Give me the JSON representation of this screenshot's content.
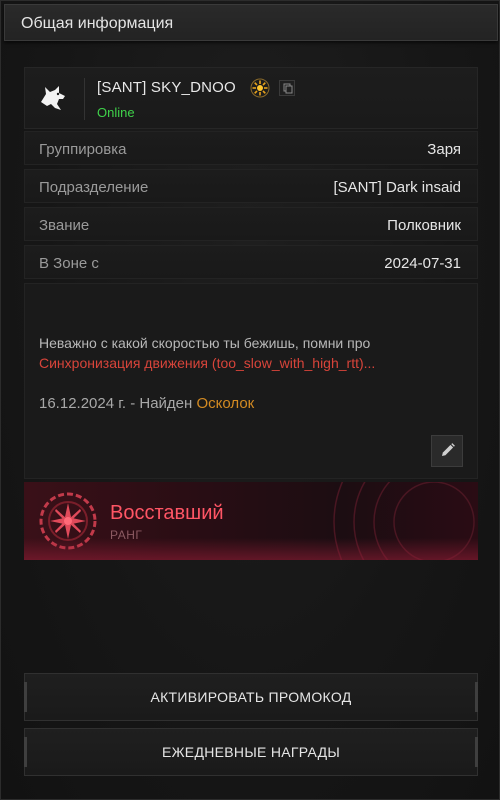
{
  "header": {
    "title": "Общая информация"
  },
  "profile": {
    "name": "[SANT] SKY_DNOO",
    "status": "Online",
    "colors": {
      "status": "#3fd14a",
      "badge": "#e8a21a"
    }
  },
  "info_rows": [
    {
      "label": "Группировка",
      "value": "Заря"
    },
    {
      "label": "Подразделение",
      "value": "[SANT] Dark insaid"
    },
    {
      "label": "Звание",
      "value": "Полковник"
    },
    {
      "label": "В Зоне с",
      "value": "2024-07-31"
    }
  ],
  "note": {
    "line1": "Неважно с какой скоростью ты бежишь, помни про",
    "line2": "Синхронизация движения (too_slow_with_high_rtt)...",
    "date_prefix": "16.12.2024 г. - Найден ",
    "date_link": "Осколок",
    "colors": {
      "highlight": "#d7443a",
      "link": "#d28a22"
    }
  },
  "rank": {
    "title": "Восставший",
    "subtitle": "РАНГ",
    "colors": {
      "title": "#ff5565"
    }
  },
  "buttons": {
    "promo": "АКТИВИРОВАТЬ ПРОМОКОД",
    "daily": "ЕЖЕДНЕВНЫЕ НАГРАДЫ"
  },
  "icons": {
    "logo": "wolf-logo-icon",
    "badge": "sun-badge-icon",
    "copy": "copy-icon",
    "edit": "pencil-icon",
    "rank": "rank-emblem-icon"
  }
}
